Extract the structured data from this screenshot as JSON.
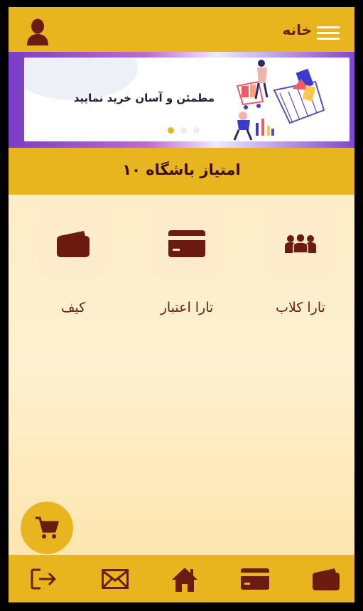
{
  "header": {
    "title": "خانه",
    "menu_icon": "hamburger-menu-icon",
    "profile_icon": "user-icon"
  },
  "banner": {
    "text": "مطمئن و آسان خرید نمایید",
    "slides_total": 3,
    "active_slide": 1
  },
  "club": {
    "label": "امتیاز باشگاه ۱۰"
  },
  "tiles": [
    {
      "label": "تارا کلاب",
      "icon": "group-icon"
    },
    {
      "label": "تارا اعتبار",
      "icon": "credit-card-icon"
    },
    {
      "label": "کیف",
      "icon": "wallet-icon"
    }
  ],
  "fab": {
    "icon": "cart-icon"
  },
  "bottom_nav": [
    {
      "icon": "logout-icon"
    },
    {
      "icon": "mail-icon"
    },
    {
      "icon": "home-icon"
    },
    {
      "icon": "credit-card-icon"
    },
    {
      "icon": "wallet-icon"
    }
  ],
  "colors": {
    "accent": "#e8b51e",
    "icon_dark": "#6b1b10",
    "background": "#fde9b6",
    "tile_bg": "#fdeccc"
  }
}
